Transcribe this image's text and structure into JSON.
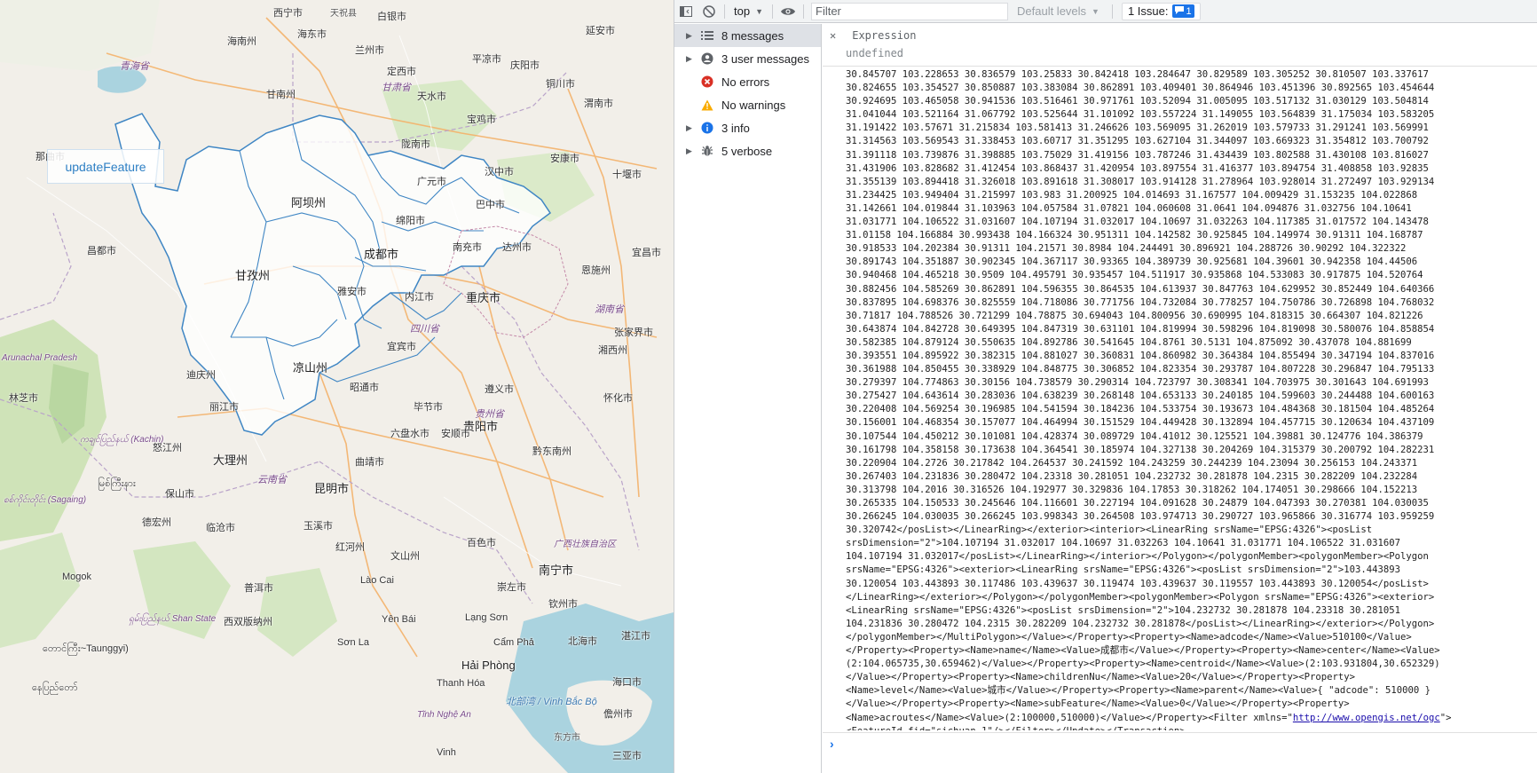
{
  "map": {
    "update_button_label": "updateFeature",
    "places": [
      {
        "text": "西宁市"
      },
      {
        "text": "天祝县"
      },
      {
        "text": "白银市"
      },
      {
        "text": "延安市"
      },
      {
        "text": "海南州"
      },
      {
        "text": "海东市"
      },
      {
        "text": "兰州市"
      },
      {
        "text": "青海省"
      },
      {
        "text": "定西市"
      },
      {
        "text": "平凉市"
      },
      {
        "text": "庆阳市"
      },
      {
        "text": "甘肃省"
      },
      {
        "text": "铜川市"
      },
      {
        "text": "甘南州"
      },
      {
        "text": "天水市"
      },
      {
        "text": "宝鸡市"
      },
      {
        "text": "渭南市"
      },
      {
        "text": "陇南市"
      },
      {
        "text": "汉中市"
      },
      {
        "text": "安康市"
      },
      {
        "text": "十堰市"
      },
      {
        "text": "阿坝州"
      },
      {
        "text": "巴中市"
      },
      {
        "text": "广元市"
      },
      {
        "text": "达州市"
      },
      {
        "text": "绵阳市"
      },
      {
        "text": "南充市"
      },
      {
        "text": "成都市"
      },
      {
        "text": "甘孜州"
      },
      {
        "text": "雅安市"
      },
      {
        "text": "重庆市"
      },
      {
        "text": "内江市"
      },
      {
        "text": "宜宾市"
      },
      {
        "text": "凉山州"
      },
      {
        "text": "昭通市"
      },
      {
        "text": "贵阳市"
      },
      {
        "text": "毕节市"
      },
      {
        "text": "六盘水市"
      },
      {
        "text": "安顺市"
      },
      {
        "text": "遵义市"
      },
      {
        "text": "黔东南州"
      },
      {
        "text": "怀化市"
      },
      {
        "text": "张家界市"
      },
      {
        "text": "湘西州"
      },
      {
        "text": "恩施州"
      },
      {
        "text": "宜昌市"
      },
      {
        "text": "丽江市"
      },
      {
        "text": "大理州"
      },
      {
        "text": "保山市"
      },
      {
        "text": "昆明市"
      },
      {
        "text": "曲靖市"
      },
      {
        "text": "玉溪市"
      },
      {
        "text": "红河州"
      },
      {
        "text": "文山州"
      },
      {
        "text": "百色市"
      },
      {
        "text": "南宁市"
      },
      {
        "text": "崇左市"
      },
      {
        "text": "钦州市"
      },
      {
        "text": "北海市"
      },
      {
        "text": "湛江市"
      },
      {
        "text": "海口市"
      },
      {
        "text": "儋州市"
      },
      {
        "text": "三亚市"
      },
      {
        "text": "东方市"
      },
      {
        "text": "Hải Phòng"
      },
      {
        "text": "Thanh Hóa"
      },
      {
        "text": "Vinh"
      },
      {
        "text": "北部湾 / Vịnh Bắc Bộ"
      },
      {
        "text": "西双版纳州"
      },
      {
        "text": "普洱市"
      },
      {
        "text": "临沧市"
      },
      {
        "text": "德宏州"
      },
      {
        "text": "Arunachal Pradesh"
      },
      {
        "text": "ကချင်ပြည်နယ် (Kachin)"
      },
      {
        "text": "စစ်ကိုင်းတိုင်း (Sagaing)"
      },
      {
        "text": "ရှမ်းပြည်နယ် Shan State"
      },
      {
        "text": "မြစ်ကြီးနား"
      },
      {
        "text": "တောင်ကြီး~Taunggyi)"
      },
      {
        "text": "နေပြည်တော်"
      },
      {
        "text": "Mogok"
      },
      {
        "text": "Lào Cai"
      },
      {
        "text": "Sơn La"
      },
      {
        "text": "Yên Bái"
      },
      {
        "text": "Lạng Sơn"
      },
      {
        "text": "Cẩm Phả"
      },
      {
        "text": "Tĩnh Nghệ An"
      },
      {
        "text": "四川省"
      },
      {
        "text": "贵州省"
      },
      {
        "text": "云南省"
      },
      {
        "text": "湖南省"
      },
      {
        "text": "广西壮族自治区"
      },
      {
        "text": "怒江州"
      },
      {
        "text": "迪庆州"
      },
      {
        "text": "林芝市"
      },
      {
        "text": "昌都市"
      },
      {
        "text": "那曲市"
      }
    ]
  },
  "devtools": {
    "toolbar": {
      "context": "top",
      "filter_placeholder": "Filter",
      "levels_label": "Default levels",
      "issues_label": "1 Issue:",
      "issues_count": "1"
    },
    "sidebar": [
      {
        "label": "8 messages",
        "icon": "list-icon",
        "selected": true
      },
      {
        "label": "3 user messages",
        "icon": "user-icon",
        "selected": false
      },
      {
        "label": "No errors",
        "icon": "error-icon",
        "selected": false
      },
      {
        "label": "No warnings",
        "icon": "warning-icon",
        "selected": false
      },
      {
        "label": "3 info",
        "icon": "info-icon",
        "selected": false
      },
      {
        "label": "5 verbose",
        "icon": "bug-icon",
        "selected": false
      }
    ],
    "expression": {
      "label": "Expression",
      "value": "undefined"
    },
    "log_lines": [
      "30.845707 103.228653 30.836579 103.25833 30.842418 103.284647 30.829589 103.305252 30.810507 103.337617",
      "30.824655 103.354527 30.850887 103.383084 30.862891 103.409401 30.864946 103.451396 30.892565 103.454644",
      "30.924695 103.465058 30.941536 103.516461 30.971761 103.52094 31.005095 103.517132 31.030129 103.504814",
      "31.041044 103.521164 31.067792 103.525644 31.101092 103.557224 31.149055 103.564839 31.175034 103.583205",
      "31.191422 103.57671 31.215834 103.581413 31.246626 103.569095 31.262019 103.579733 31.291241 103.569991",
      "31.314563 103.569543 31.338453 103.60717 31.351295 103.627104 31.344097 103.669323 31.354812 103.700792",
      "31.391118 103.739876 31.398885 103.75029 31.419156 103.787246 31.434439 103.802588 31.430108 103.816027",
      "31.431906 103.828682 31.412454 103.868437 31.420954 103.897554 31.416377 103.894754 31.408858 103.92835",
      "31.355139 103.894418 31.326018 103.891618 31.308017 103.914128 31.278964 103.928014 31.272497 103.929134",
      "31.234425 103.949404 31.215997 103.983 31.200925 104.014693 31.167577 104.009429 31.153235 104.022868",
      "31.142661 104.019844 31.103963 104.057584 31.07821 104.060608 31.0641 104.094876 31.032756 104.10641",
      "31.031771 104.106522 31.031607 104.107194 31.032017 104.10697 31.032263 104.117385 31.017572 104.143478",
      "31.01158 104.166884 30.993438 104.166324 30.951311 104.142582 30.925845 104.149974 30.91311 104.168787",
      "30.918533 104.202384 30.91311 104.21571 30.8984 104.244491 30.896921 104.288726 30.90292 104.322322",
      "30.891743 104.351887 30.902345 104.367117 30.93365 104.389739 30.925681 104.39601 30.942358 104.44506",
      "30.940468 104.465218 30.9509 104.495791 30.935457 104.511917 30.935868 104.533083 30.917875 104.520764",
      "30.882456 104.585269 30.862891 104.596355 30.864535 104.613937 30.847763 104.629952 30.852449 104.640366",
      "30.837895 104.698376 30.825559 104.718086 30.771756 104.732084 30.778257 104.750786 30.726898 104.768032",
      "30.71817 104.788526 30.721299 104.78875 30.694043 104.800956 30.690995 104.818315 30.664307 104.821226",
      "30.643874 104.842728 30.649395 104.847319 30.631101 104.819994 30.598296 104.819098 30.580076 104.858854",
      "30.582385 104.879124 30.550635 104.892786 30.541645 104.8761 30.5131 104.875092 30.437078 104.881699",
      "30.393551 104.895922 30.382315 104.881027 30.360831 104.860982 30.364384 104.855494 30.347194 104.837016",
      "30.361988 104.850455 30.338929 104.848775 30.306852 104.823354 30.293787 104.807228 30.296847 104.795133",
      "30.279397 104.774863 30.30156 104.738579 30.290314 104.723797 30.308341 104.703975 30.301643 104.691993",
      "30.275427 104.643614 30.283036 104.638239 30.268148 104.653133 30.240185 104.599603 30.244488 104.600163",
      "30.220408 104.569254 30.196985 104.541594 30.184236 104.533754 30.193673 104.484368 30.181504 104.485264",
      "30.156001 104.468354 30.157077 104.464994 30.151529 104.449428 30.132894 104.457715 30.120634 104.437109",
      "30.107544 104.450212 30.101081 104.428374 30.089729 104.41012 30.125521 104.39881 30.124776 104.386379",
      "30.161798 104.358158 30.173638 104.364541 30.185974 104.327138 30.204269 104.315379 30.200792 104.282231",
      "30.220904 104.2726 30.217842 104.264537 30.241592 104.243259 30.244239 104.23094 30.256153 104.243371",
      "30.267403 104.231836 30.280472 104.23318 30.281051 104.232732 30.281878 104.2315 30.282209 104.232284",
      "30.313798 104.2016 30.316526 104.192977 30.329836 104.17853 30.318262 104.174051 30.298666 104.152213",
      "30.265335 104.150533 30.245646 104.116601 30.227194 104.091628 30.24879 104.047393 30.270381 104.030035",
      "30.266245 104.030035 30.266245 103.998343 30.264508 103.974713 30.290727 103.965866 30.316774 103.959259",
      "30.320742</posList></LinearRing></exterior><interior><LinearRing srsName=\"EPSG:4326\"><posList",
      "srsDimension=\"2\">104.107194 31.032017 104.10697 31.032263 104.10641 31.031771 104.106522 31.031607",
      "104.107194 31.032017</posList></LinearRing></interior></Polygon></polygonMember><polygonMember><Polygon",
      "srsName=\"EPSG:4326\"><exterior><LinearRing srsName=\"EPSG:4326\"><posList srsDimension=\"2\">103.443893",
      "30.120054 103.443893 30.117486 103.439637 30.119474 103.439637 30.119557 103.443893 30.120054</posList>",
      "</LinearRing></exterior></Polygon></polygonMember><polygonMember><Polygon srsName=\"EPSG:4326\"><exterior>",
      "<LinearRing srsName=\"EPSG:4326\"><posList srsDimension=\"2\">104.232732 30.281878 104.23318 30.281051",
      "104.231836 30.280472 104.2315 30.282209 104.232732 30.281878</posList></LinearRing></exterior></Polygon>",
      "</polygonMember></MultiPolygon></Value></Property><Property><Name>adcode</Name><Value>510100</Value>",
      "</Property><Property><Name>name</Name><Value>成都市</Value></Property><Property><Name>center</Name><Value>",
      "(2:104.065735,30.659462)</Value></Property><Property><Name>centroid</Name><Value>(2:103.931804,30.652329)",
      "</Value></Property><Property><Name>childrenNu</Name><Value>20</Value></Property><Property>",
      "<Name>level</Name><Value>城市</Value></Property><Property><Name>parent</Name><Value>{ \"adcode\": 510000 }",
      "</Value></Property><Property><Name>subFeature</Name><Value>0</Value></Property><Property>",
      "<Name>acroutes</Name><Value>(2:100000,510000)</Value></Property><Filter xmlns=\"",
      "<FeatureId fid=\"sichuan.1\"/></Filter></Update></Transaction>"
    ],
    "filter_link_text": "http://www.opengis.net/ogc",
    "filter_link_tail": "\">",
    "prompt_symbol": "›"
  }
}
